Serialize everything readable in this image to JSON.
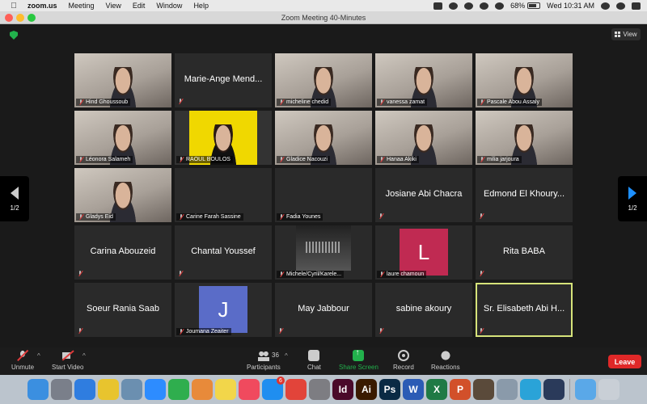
{
  "menubar": {
    "app_name": "zoom.us",
    "menus": [
      "Meeting",
      "View",
      "Edit",
      "Window",
      "Help"
    ],
    "battery": "68%",
    "clock": "Wed 10:31 AM"
  },
  "window": {
    "title": "Zoom Meeting   40-Minutes"
  },
  "meeting": {
    "view_label": "View",
    "page_indicator_left": "1/2",
    "page_indicator_right": "1/2"
  },
  "tiles": [
    {
      "name": "Hind Ghoussoub",
      "kind": "video"
    },
    {
      "name": "Marie-Ange Mend...",
      "kind": "name"
    },
    {
      "name": "micheline chedid",
      "kind": "video"
    },
    {
      "name": "vanessa zamat",
      "kind": "video"
    },
    {
      "name": "Pascale Abou Assaly",
      "kind": "video"
    },
    {
      "name": "Léonora Salameh",
      "kind": "video"
    },
    {
      "name": "RAOUL BOULOS",
      "kind": "yellow"
    },
    {
      "name": "Gladice Nacouzi",
      "kind": "video"
    },
    {
      "name": "Hanaa Akiki",
      "kind": "video"
    },
    {
      "name": "milia jarjoura",
      "kind": "video"
    },
    {
      "name": "Gladys Eid",
      "kind": "video"
    },
    {
      "name": "Carine Farah Sassine",
      "kind": "blank"
    },
    {
      "name": "Fadia Younes",
      "kind": "blank"
    },
    {
      "name": "Josiane Abi Chacra",
      "kind": "name"
    },
    {
      "name": "Edmond El Khoury...",
      "kind": "name"
    },
    {
      "name": "Carina Abouzeid",
      "kind": "name"
    },
    {
      "name": "Chantal Youssef",
      "kind": "name"
    },
    {
      "name": "Michele/Cyril/Karele...",
      "kind": "picture"
    },
    {
      "name": "laure chamoun",
      "kind": "avatar",
      "initial": "L",
      "color": "#c02a52"
    },
    {
      "name": "Rita BABA",
      "kind": "name"
    },
    {
      "name": "Soeur Rania Saab",
      "kind": "name"
    },
    {
      "name": "Joumana Zeaiter",
      "kind": "avatar",
      "initial": "J",
      "color": "#5a6cc8"
    },
    {
      "name": "May Jabbour",
      "kind": "name"
    },
    {
      "name": "sabine akoury",
      "kind": "name"
    },
    {
      "name": "Sr. Elisabeth Abi H...",
      "kind": "name",
      "selected": true
    }
  ],
  "controls": {
    "unmute": "Unmute",
    "start_video": "Start Video",
    "participants": "Participants",
    "participant_count": "36",
    "chat": "Chat",
    "share_screen": "Share Screen",
    "record": "Record",
    "reactions": "Reactions",
    "leave": "Leave",
    "share_color": "#22b14c",
    "leave_color": "#e02828"
  },
  "dock": {
    "apps": [
      {
        "icon": "finder-icon",
        "color": "#3b8fe0"
      },
      {
        "icon": "launchpad-icon",
        "color": "#7a7f8a"
      },
      {
        "icon": "safari-icon",
        "color": "#2f7de0"
      },
      {
        "icon": "chrome-icon",
        "color": "#e8c42e"
      },
      {
        "icon": "preview-icon",
        "color": "#6b8fb0"
      },
      {
        "icon": "zoom-icon",
        "color": "#2d8cff"
      },
      {
        "icon": "facetime-icon",
        "color": "#2fae4e"
      },
      {
        "icon": "photos-icon",
        "color": "#e88a3a"
      },
      {
        "icon": "notes-icon",
        "color": "#f2d64a"
      },
      {
        "icon": "music-icon",
        "color": "#f04a5e"
      },
      {
        "icon": "appstore-icon",
        "color": "#1f8ef0",
        "badge": "6"
      },
      {
        "icon": "anydesk-icon",
        "color": "#e2443a"
      },
      {
        "icon": "system-preferences-icon",
        "color": "#7d7d82"
      },
      {
        "icon": "indesign-icon",
        "color": "#4a0a2a",
        "glyph": "Id"
      },
      {
        "icon": "illustrator-icon",
        "color": "#3a1a00",
        "glyph": "Ai"
      },
      {
        "icon": "photoshop-icon",
        "color": "#0a2a44",
        "glyph": "Ps"
      },
      {
        "icon": "word-icon",
        "color": "#2b5bb5",
        "glyph": "W"
      },
      {
        "icon": "excel-icon",
        "color": "#1f7a45",
        "glyph": "X"
      },
      {
        "icon": "powerpoint-icon",
        "color": "#d2502a",
        "glyph": "P"
      },
      {
        "icon": "game-icon",
        "color": "#5a4a3a"
      },
      {
        "icon": "image-capture-icon",
        "color": "#8a9aaa"
      },
      {
        "icon": "accessibility-icon",
        "color": "#2aa3d8"
      },
      {
        "icon": "quicktime-icon",
        "color": "#2a3a5a"
      },
      {
        "icon": "downloads-folder-icon",
        "color": "#5aa8e8"
      },
      {
        "icon": "trash-icon",
        "color": "#c9cfd6"
      }
    ]
  }
}
